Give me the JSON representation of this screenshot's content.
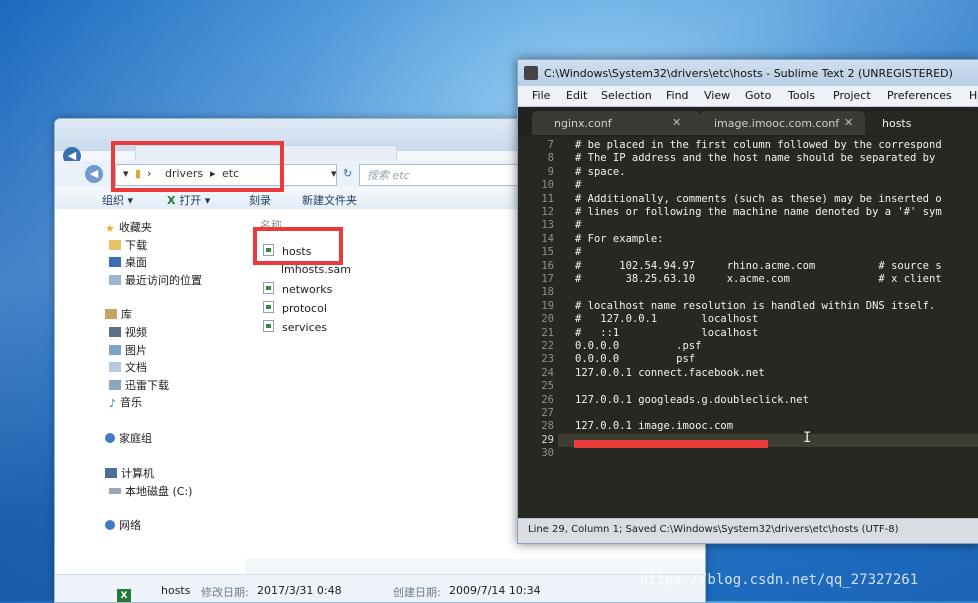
{
  "explorer": {
    "breadcrumb": [
      "drivers",
      "etc"
    ],
    "search_placeholder": "搜索 etc",
    "toolbar": [
      "组织 ▾",
      "打开 ▾",
      "刻录",
      "新建文件夹"
    ],
    "nav": {
      "favorites": "收藏夹",
      "favorites_items": [
        "下载",
        "桌面",
        "最近访问的位置"
      ],
      "libraries": "库",
      "library_items": [
        "视频",
        "图片",
        "文档",
        "迅雷下载",
        "音乐"
      ],
      "homegroup": "家庭组",
      "computer": "计算机",
      "drive": "本地磁盘 (C:)",
      "network": "网络"
    },
    "column_header": "名称",
    "files": [
      "hosts",
      "lmhosts.sam",
      "networks",
      "protocol",
      "services"
    ],
    "details": {
      "name": "hosts",
      "modified_label": "修改日期:",
      "modified_value": "2017/3/31 0:48",
      "created_label": "创建日期:",
      "created_value": "2009/7/14 10:34"
    }
  },
  "sublime": {
    "title": "C:\\Windows\\System32\\drivers\\etc\\hosts - Sublime Text 2 (UNREGISTERED)",
    "menu": [
      "File",
      "Edit",
      "Selection",
      "Find",
      "View",
      "Goto",
      "Tools",
      "Project",
      "Preferences",
      "H"
    ],
    "tabs": [
      "nginx.conf",
      "image.imooc.com.conf",
      "hosts"
    ],
    "active_tab": 2,
    "lines": [
      {
        "no": "7",
        "text": "# be placed in the first column followed by the correspond"
      },
      {
        "no": "8",
        "text": "# The IP address and the host name should be separated by"
      },
      {
        "no": "9",
        "text": "# space."
      },
      {
        "no": "10",
        "text": "#"
      },
      {
        "no": "11",
        "text": "# Additionally, comments (such as these) may be inserted o"
      },
      {
        "no": "12",
        "text": "# lines or following the machine name denoted by a '#' sym"
      },
      {
        "no": "13",
        "text": "#"
      },
      {
        "no": "14",
        "text": "# For example:"
      },
      {
        "no": "15",
        "text": "#"
      },
      {
        "no": "16",
        "text": "#      102.54.94.97     rhino.acme.com          # source s"
      },
      {
        "no": "17",
        "text": "#       38.25.63.10     x.acme.com              # x client"
      },
      {
        "no": "18",
        "text": ""
      },
      {
        "no": "19",
        "text": "# localhost name resolution is handled within DNS itself."
      },
      {
        "no": "20",
        "text": "#   127.0.0.1       localhost"
      },
      {
        "no": "21",
        "text": "#   ::1             localhost"
      },
      {
        "no": "22",
        "text": "0.0.0.0         .psf"
      },
      {
        "no": "23",
        "text": "0.0.0.0         psf"
      },
      {
        "no": "24",
        "text": "127.0.0.1 connect.facebook.net"
      },
      {
        "no": "25",
        "text": ""
      },
      {
        "no": "26",
        "text": "127.0.0.1 googleads.g.doubleclick.net"
      },
      {
        "no": "27",
        "text": ""
      },
      {
        "no": "28",
        "text": "127.0.0.1 image.imooc.com"
      },
      {
        "no": "29",
        "text": ""
      },
      {
        "no": "30",
        "text": ""
      }
    ],
    "current_line": "29",
    "status": "Line 29, Column 1; Saved C:\\Windows\\System32\\drivers\\etc\\hosts (UTF-8)"
  },
  "watermark": "https://blog.csdn.net/qq_27327261",
  "colors": {
    "highlight_red": "#ea3a3a",
    "editor_bg": "#272822",
    "desktop_blue": "#3f8fd6"
  }
}
